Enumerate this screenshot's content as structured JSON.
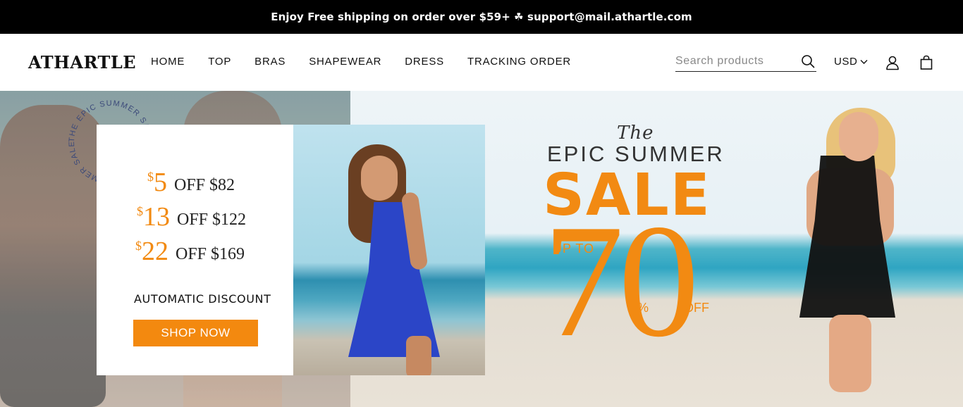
{
  "announcement": {
    "text": "Enjoy Free shipping on order over $59+ ☘ support@mail.athartle.com"
  },
  "header": {
    "logo": "ATHARTLE",
    "nav": [
      {
        "label": "HOME"
      },
      {
        "label": "TOP"
      },
      {
        "label": "BRAS"
      },
      {
        "label": "SHAPEWEAR"
      },
      {
        "label": "DRESS"
      },
      {
        "label": "TRACKING ORDER"
      }
    ],
    "search": {
      "placeholder": "Search products"
    },
    "currency": {
      "label": "USD"
    }
  },
  "hero": {
    "circle_text": "THE EPIC SUMMER SALE THE EPIC SUMMER SALE",
    "offers": [
      {
        "currency_symbol": "$",
        "amount": "5",
        "text": "OFF $82"
      },
      {
        "currency_symbol": "$",
        "amount": "13",
        "text": "OFF $122"
      },
      {
        "currency_symbol": "$",
        "amount": "22",
        "text": "OFF $169"
      }
    ],
    "automatic_discount": "AUTOMATIC DISCOUNT",
    "shop_now": "SHOP NOW",
    "the": "The",
    "epic_summer": "EPIC SUMMER",
    "sale": "SALE",
    "up_to": "UP TO",
    "percent_value": "70",
    "percent_symbol": "%",
    "off": "OFF",
    "accent_color": "#f28a12"
  },
  "icons": {
    "search": "search-icon",
    "account": "account-icon",
    "cart": "shopping-bag-icon",
    "chevron": "chevron-down-icon"
  }
}
